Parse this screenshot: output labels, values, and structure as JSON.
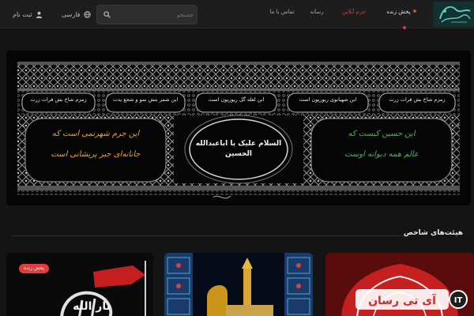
{
  "header": {
    "account_label": "ثبت نام",
    "language_label": "فارسی",
    "search_placeholder": "جستجو",
    "nav": {
      "live": "پخش زنده",
      "shrine_online": "حرم آنلاین",
      "media": "رسانه",
      "contact": "تماس با ما"
    },
    "accent_color": "#e23c3c"
  },
  "banner": {
    "header_texts": [
      "زمزم شاخ بش فرات زرت",
      "ابن شهبانوی ریوریون است",
      "ابن لعله گل ریوریون است",
      "ابن شمر بتش نمو و شجع یدت",
      "زمزم شاخ بش فرات زرت"
    ],
    "center_text": "السلام علیک یا اباعبدالله الحسین",
    "left_text_line1": "این جرم شهرنمی است که",
    "left_text_line2": "جانانه‌ای جبر پریشانی است",
    "right_text_line1": "این حسین کیست که",
    "right_text_line2": "عالم همه دیوانه اوست"
  },
  "section": {
    "title": "هیئت‌های شاخص"
  },
  "cards": [
    {
      "badge": "پخش زنده",
      "calligraphy": "ثار الله"
    },
    {
      "title": ""
    },
    {
      "title": ""
    }
  ],
  "watermark": "آی تی رسان"
}
